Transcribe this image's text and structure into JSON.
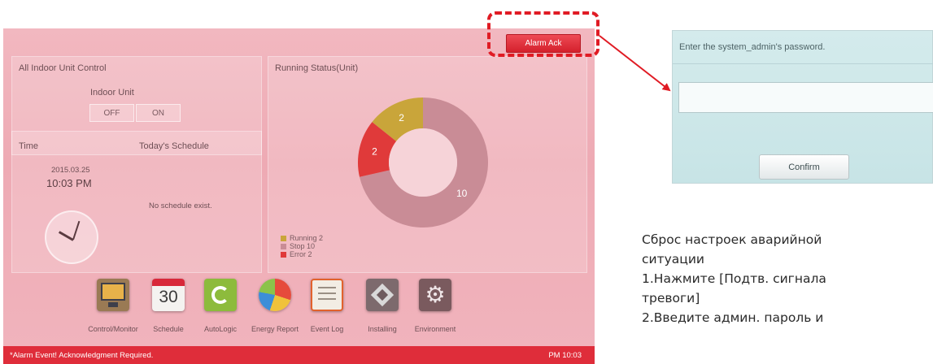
{
  "alarm_button_label": "Alarm Ack",
  "indoor_control": {
    "title": "All Indoor Unit Control",
    "unit_label": "Indoor Unit",
    "off_label": "OFF",
    "on_label": "ON"
  },
  "time_panel": {
    "title": "Time",
    "schedule_title": "Today's Schedule",
    "date": "2015.03.25",
    "time": "10:03 PM",
    "schedule_message": "No schedule exist."
  },
  "running_status": {
    "title": "Running Status(Unit)",
    "colors": {
      "running": "#c9a53a",
      "stop": "#c98c96",
      "error": "#e03a3a"
    },
    "segments": [
      {
        "key": "stop",
        "value": 10,
        "label": "10"
      },
      {
        "key": "error",
        "value": 2,
        "label": "2"
      },
      {
        "key": "running",
        "value": 2,
        "label": "2"
      }
    ],
    "legend": [
      "Running 2",
      "Stop 10",
      "Error 2"
    ]
  },
  "toolbar": {
    "items": [
      {
        "label": "Control/Monitor",
        "icon": "monitor-icon"
      },
      {
        "label": "Schedule",
        "icon": "calendar-icon",
        "badge": "30"
      },
      {
        "label": "AutoLogic",
        "icon": "cycle-icon"
      },
      {
        "label": "Energy Report",
        "icon": "pie-chart-icon"
      },
      {
        "label": "Event Log",
        "icon": "log-icon"
      },
      {
        "label": "Installing",
        "icon": "indoor-unit-icon"
      },
      {
        "label": "Environment",
        "icon": "gear-icon"
      }
    ]
  },
  "status_bar": {
    "message": "*Alarm Event! Acknowledgment Required.",
    "time": "PM 10:03"
  },
  "dialog": {
    "title": "Enter the system_admin's password.",
    "confirm_label": "Confirm"
  },
  "instructions": {
    "lines": [
      "Сброс настроек аварийной",
      "ситуации",
      "1.Нажмите [Подтв. сигнала",
      "тревоги]",
      "2.Введите админ. пароль и"
    ]
  }
}
